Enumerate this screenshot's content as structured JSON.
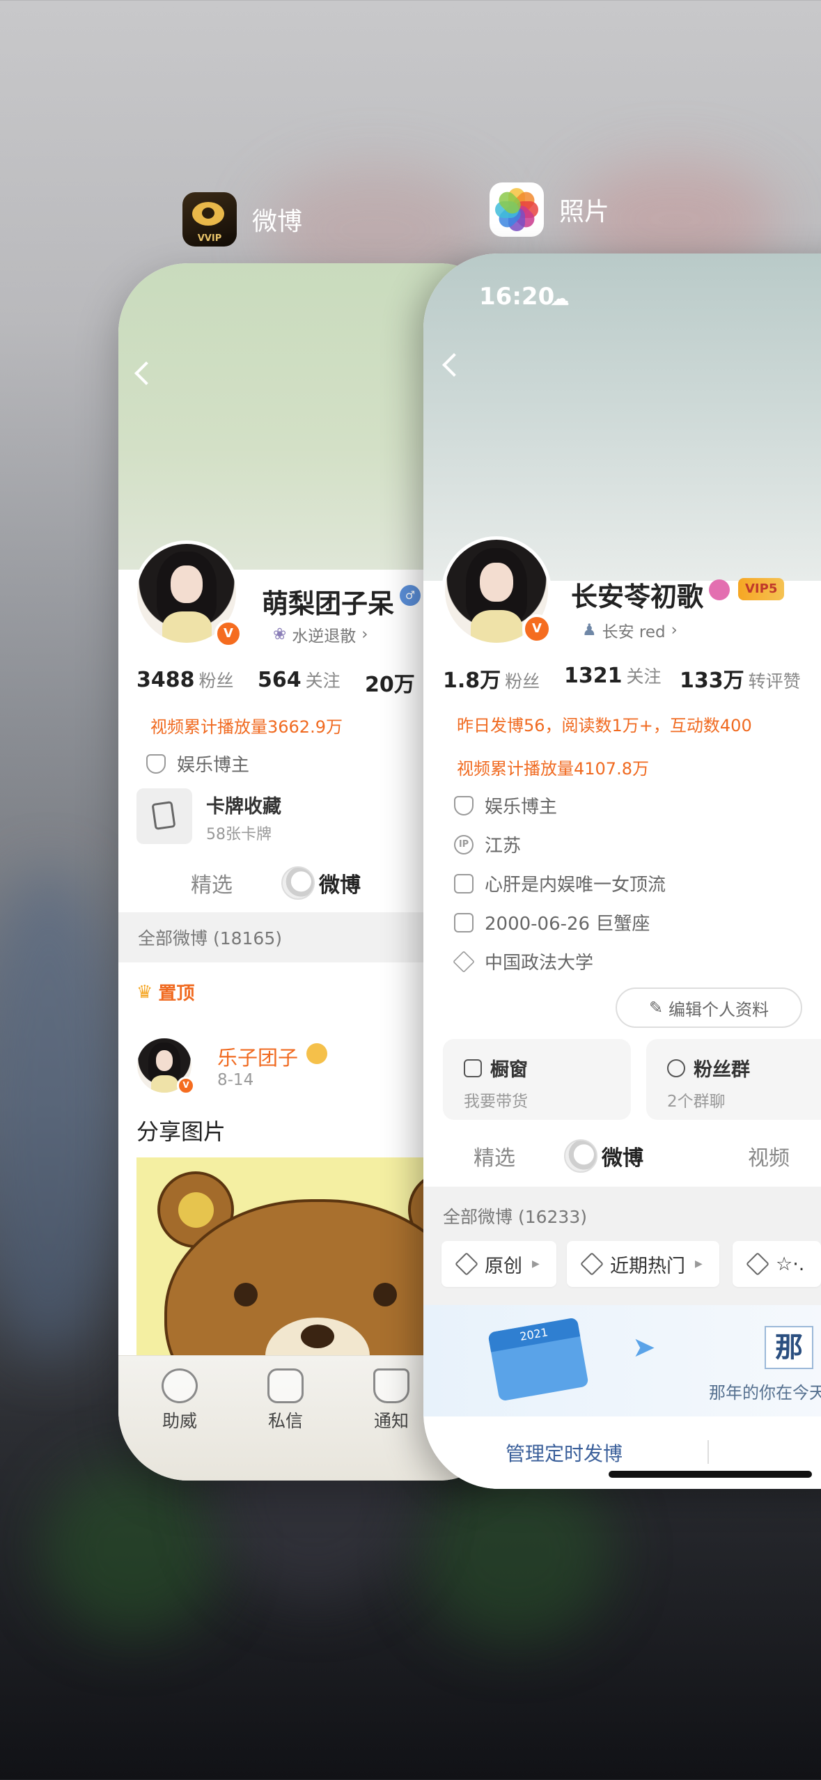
{
  "switcher": {
    "left_app_name": "微博",
    "left_app_badge": "VVIP",
    "right_app_name": "照片"
  },
  "left_card": {
    "profile": {
      "name": "萌梨团子呆",
      "badge_label": "水逆退散",
      "verified_mark": "V",
      "stats": [
        {
          "num": "3488",
          "label": "粉丝"
        },
        {
          "num": "564",
          "label": "关注"
        },
        {
          "num": "20万",
          "label": ""
        }
      ],
      "video_plays": "视频累计播放量3662.9万",
      "category": "娱乐博主",
      "card_title": "卡牌收藏",
      "card_sub": "58张卡牌"
    },
    "tabs": [
      "精选",
      "微博"
    ],
    "all_weibo": "全部微博 (18165)",
    "pinned": "置顶",
    "post": {
      "author": "乐子团子",
      "date": "8-14",
      "text": "分享图片"
    },
    "bottom_nav": [
      "助威",
      "私信",
      "通知"
    ]
  },
  "right_card": {
    "status_time": "16:20",
    "profile": {
      "name": "长安苓初歌",
      "vip_label": "VIP5",
      "verified_mark": "V",
      "badge_label": "长安 red",
      "stats": [
        {
          "num": "1.8万",
          "label": "粉丝"
        },
        {
          "num": "1321",
          "label": "关注"
        },
        {
          "num": "133万",
          "label": "转评赞"
        }
      ],
      "activity": "昨日发博56，阅读数1万+，互动数400",
      "video_plays": "视频累计播放量4107.8万",
      "category": "娱乐博主",
      "location": "江苏",
      "ip_label": "IP",
      "bio": "心肝是内娱唯一女顶流",
      "birthday": "2000-06-26 巨蟹座",
      "school": "中国政法大学",
      "edit_button": "编辑个人资料"
    },
    "boxes": [
      {
        "title": "橱窗",
        "sub": "我要带货"
      },
      {
        "title": "粉丝群",
        "sub": "2个群聊"
      }
    ],
    "tabs": [
      "精选",
      "微博",
      "视频"
    ],
    "all_weibo": "全部微博 (16233)",
    "filters": [
      "原创",
      "近期热门",
      "☆·."
    ],
    "banner": {
      "year": "2021",
      "char": "那",
      "caption": "那年的你在今天"
    },
    "manage_button": "管理定时发博"
  }
}
